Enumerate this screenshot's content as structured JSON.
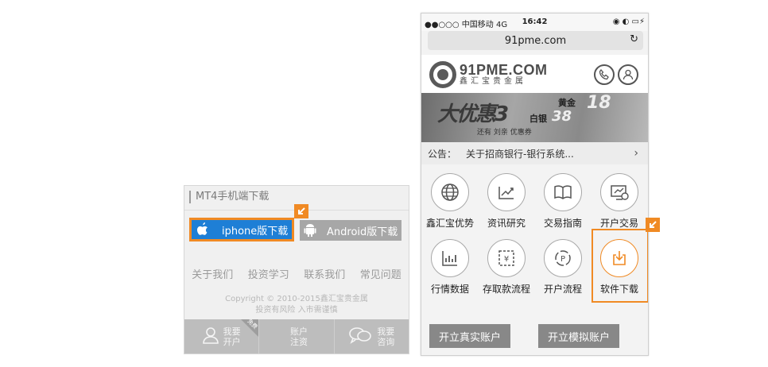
{
  "left_panel": {
    "title": "MT4手机端下载",
    "iphone_button": "iphone版下载",
    "android_button": "Android版下载",
    "links": [
      "关于我们",
      "投资学习",
      "联系我们",
      "常见问题"
    ],
    "copyright": "Copyright © 2010-2015鑫汇宝贵金属",
    "risk_note": "投资有风险 入市需谨慎",
    "bottom_bar": [
      {
        "line1": "我要",
        "line2": "开户",
        "icon": "user-icon",
        "tag": "免费"
      },
      {
        "line1": "账户",
        "line2": "注资",
        "icon": "wallet-icon"
      },
      {
        "line1": "我要",
        "line2": "咨询",
        "icon": "chat-icon"
      }
    ]
  },
  "phone": {
    "status_left": "●●○○○ 中国移动  4G",
    "status_time": "16:42",
    "status_right": "◉ ◐ ▭⚡",
    "url": "91pme.com",
    "logo_main": "91PME.COM",
    "logo_sub": "鑫汇宝贵金属",
    "banner": {
      "headline": "大优惠3",
      "gold_label": "黄金",
      "gold_value": "18",
      "silver_label": "白银",
      "silver_value": "38",
      "small_text": "还有 刘亲 优惠券"
    },
    "notice_label": "公告：",
    "notice_text": "关于招商银行-银行系统...",
    "grid_items": [
      {
        "label": "鑫汇宝优势",
        "icon": "globe-icon"
      },
      {
        "label": "资讯研究",
        "icon": "trend-chart-icon"
      },
      {
        "label": "交易指南",
        "icon": "book-icon"
      },
      {
        "label": "开户交易",
        "icon": "monitor-icon"
      },
      {
        "label": "行情数据",
        "icon": "bar-chart-icon"
      },
      {
        "label": "存取款流程",
        "icon": "money-transfer-icon"
      },
      {
        "label": "开户流程",
        "icon": "process-cycle-icon"
      },
      {
        "label": "软件下载",
        "icon": "download-icon"
      }
    ],
    "open_real_account": "开立真实账户",
    "open_demo_account": "开立模拟账户"
  },
  "colors": {
    "highlight": "#f08a24",
    "iphone_blue": "#1e7fd6",
    "button_gray": "#888888"
  }
}
